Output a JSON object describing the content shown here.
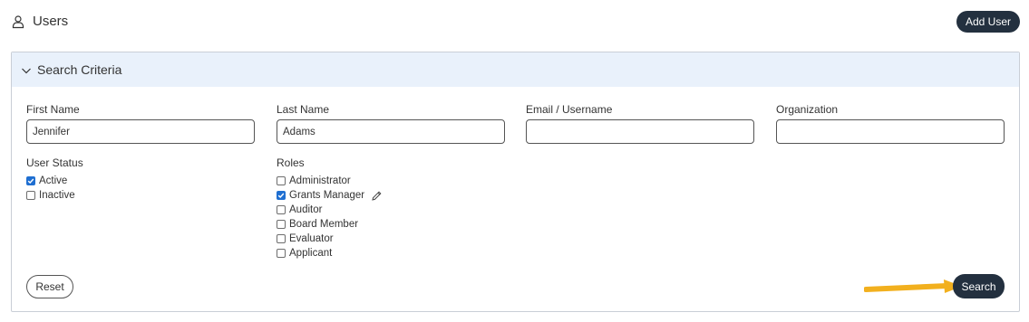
{
  "header": {
    "title": "Users",
    "add_user_label": "Add User"
  },
  "panel": {
    "title": "Search Criteria",
    "fields": {
      "first_name": {
        "label": "First Name",
        "value": "Jennifer"
      },
      "last_name": {
        "label": "Last Name",
        "value": "Adams"
      },
      "email": {
        "label": "Email / Username",
        "value": ""
      },
      "organization": {
        "label": "Organization",
        "value": ""
      }
    },
    "user_status": {
      "label": "User Status",
      "options": [
        {
          "label": "Active",
          "checked": true
        },
        {
          "label": "Inactive",
          "checked": false
        }
      ]
    },
    "roles": {
      "label": "Roles",
      "options": [
        {
          "label": "Administrator",
          "checked": false
        },
        {
          "label": "Grants Manager",
          "checked": true
        },
        {
          "label": "Auditor",
          "checked": false
        },
        {
          "label": "Board Member",
          "checked": false
        },
        {
          "label": "Evaluator",
          "checked": false
        },
        {
          "label": "Applicant",
          "checked": false
        }
      ]
    },
    "reset_label": "Reset",
    "search_label": "Search"
  },
  "colors": {
    "primary_button": "#23303f",
    "panel_header_bg": "#e9f1fb",
    "checkbox_checked": "#1f6fd1",
    "annotation_arrow": "#f2b01e"
  },
  "icons": {
    "title_icon": "user-icon",
    "panel_toggle": "chevron-down-icon",
    "role_edit": "pencil-icon",
    "annotation": "arrow-right-icon"
  }
}
